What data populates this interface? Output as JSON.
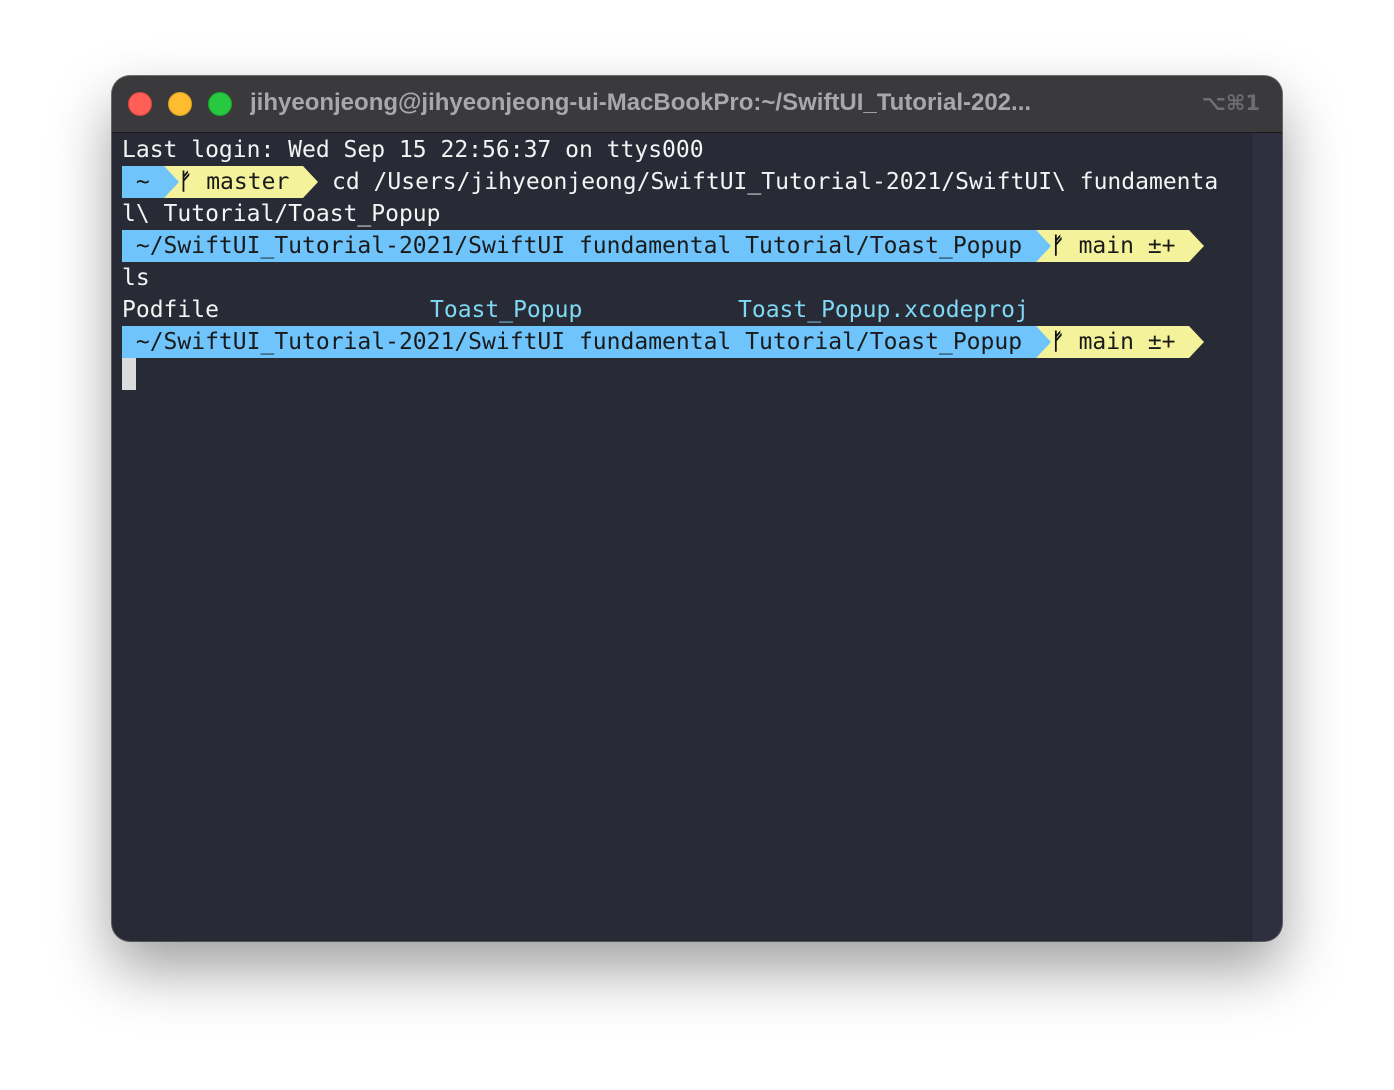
{
  "window": {
    "title": "jihyeonjeong@jihyeonjeong-ui-MacBookPro:~/SwiftUI_Tutorial-202...",
    "shortcut": "⌥⌘1"
  },
  "terminal": {
    "last_login": "Last login: Wed Sep 15 22:56:37 on ttys000",
    "prompt1": {
      "dir": " ~ ",
      "branch_icon": "ᚠ",
      "branch": " master ",
      "command_line1": " cd /Users/jihyeonjeong/SwiftUI_Tutorial-2021/SwiftUI\\ fundamenta",
      "command_line2": "l\\ Tutorial/Toast_Popup"
    },
    "prompt2": {
      "dir": " ~/SwiftUI_Tutorial-2021/SwiftUI fundamental Tutorial/Toast_Popup ",
      "branch_icon": "ᚠ",
      "branch": " main ±+ ",
      "command": "ls"
    },
    "ls_output": [
      "Podfile",
      "Toast_Popup",
      "Toast_Popup.xcodeproj"
    ],
    "prompt3": {
      "dir": " ~/SwiftUI_Tutorial-2021/SwiftUI fundamental Tutorial/Toast_Popup ",
      "branch_icon": "ᚠ",
      "branch": " main ±+ "
    }
  },
  "colors": {
    "terminal_bg": "#282a36",
    "prompt_dir_bg": "#6fc4fb",
    "prompt_git_bg": "#f4f39b",
    "directory_fg": "#7fd9f5"
  }
}
